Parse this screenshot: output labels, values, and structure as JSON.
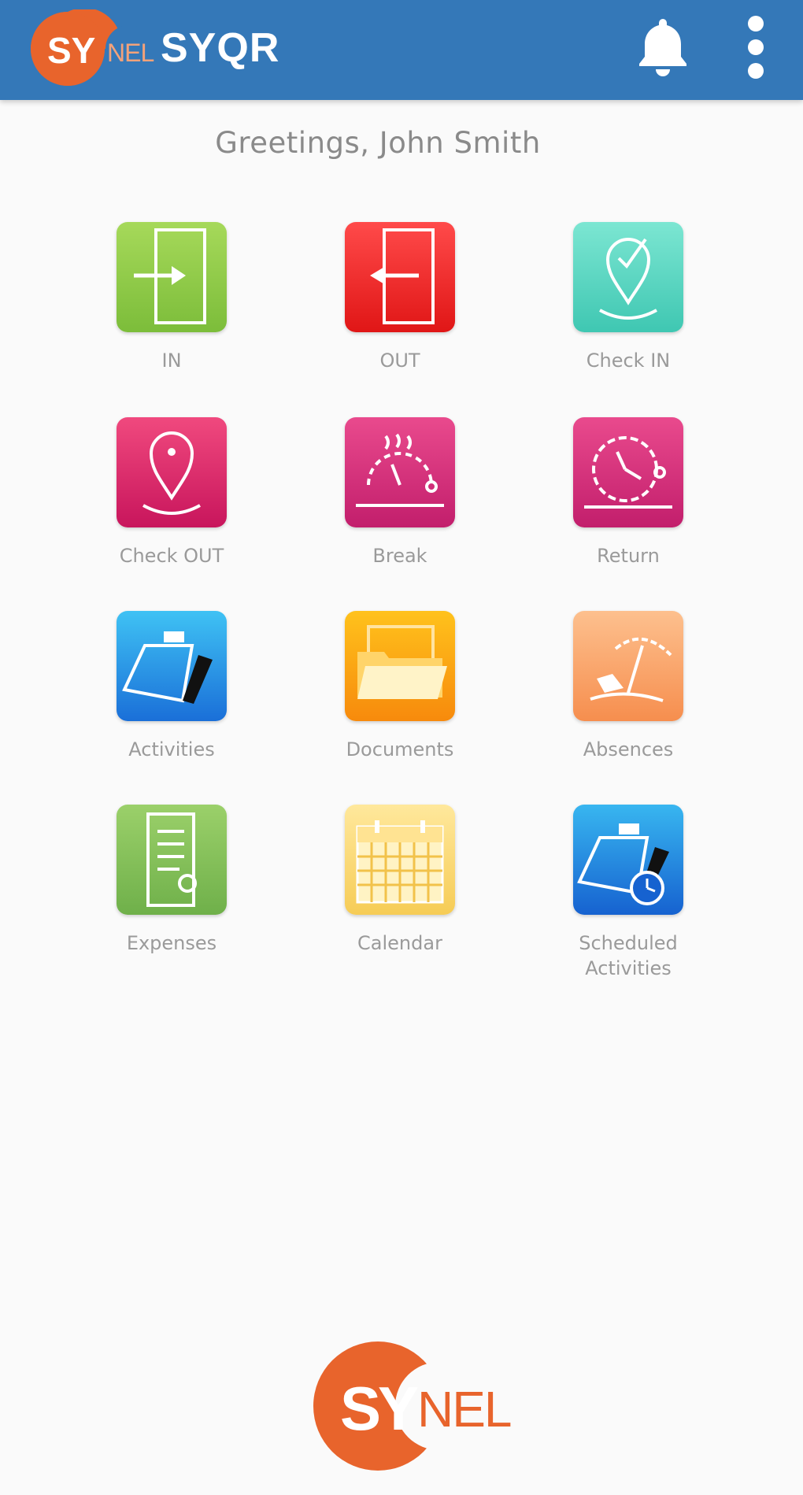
{
  "header": {
    "app_title": "SYQR",
    "logo_text_left": "SY",
    "logo_text_right": "NEL",
    "bell_icon": "bell-icon",
    "menu_icon": "more-vertical-icon",
    "bar_color": "#3478b8",
    "logo_color": "#e8642c"
  },
  "greeting": "Greetings, John Smith",
  "tiles": [
    {
      "label": "IN",
      "icon": "sign-in-icon",
      "color": "#7cbd3a"
    },
    {
      "label": "OUT",
      "icon": "sign-out-icon",
      "color": "#e01616"
    },
    {
      "label": "Check IN",
      "icon": "map-pin-check-icon",
      "color": "#3fc7b2"
    },
    {
      "label": "Check OUT",
      "icon": "map-pin-icon",
      "color": "#c8155c"
    },
    {
      "label": "Break",
      "icon": "coffee-break-icon",
      "color": "#c21e6c"
    },
    {
      "label": "Return",
      "icon": "clock-return-icon",
      "color": "#c21e6c"
    },
    {
      "label": "Activities",
      "icon": "clipboard-pen-icon",
      "color": "#1a6fd8"
    },
    {
      "label": "Documents",
      "icon": "folder-icon",
      "color": "#f78a0c"
    },
    {
      "label": "Absences",
      "icon": "beach-umbrella-icon",
      "color": "#f68e4e"
    },
    {
      "label": "Expenses",
      "icon": "receipt-icon",
      "color": "#6fb04a"
    },
    {
      "label": "Calendar",
      "icon": "calendar-icon",
      "color": "#f6cc56"
    },
    {
      "label": "Scheduled Activities",
      "icon": "clipboard-clock-icon",
      "color": "#1662d0"
    }
  ],
  "footer": {
    "logo_text_left": "SY",
    "logo_text_right": "NEL"
  }
}
